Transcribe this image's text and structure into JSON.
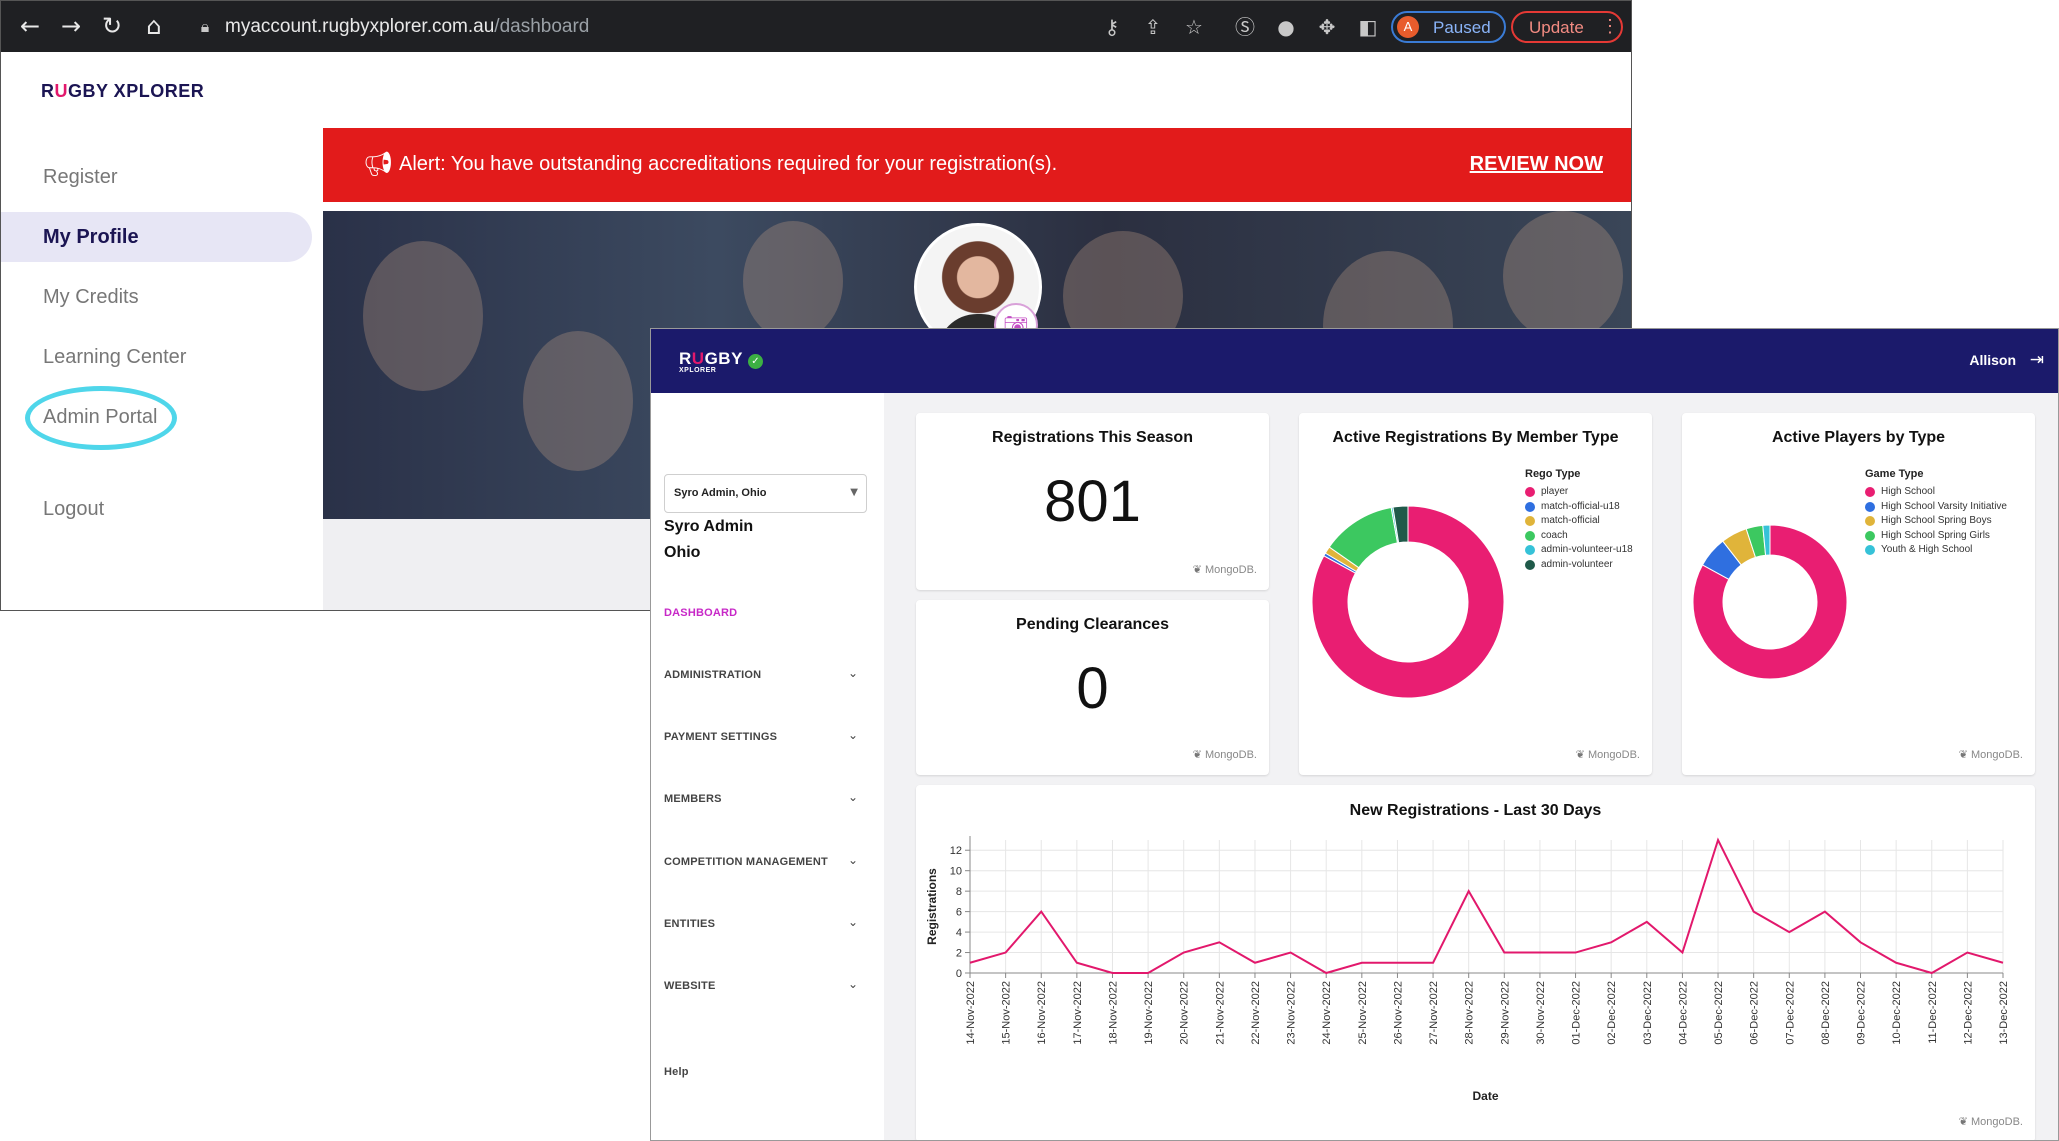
{
  "browser": {
    "url_domain": "myaccount.rugbyxplorer.com.au",
    "url_path": "/dashboard",
    "profile_initial": "A",
    "profile_status": "Paused",
    "update_label": "Update"
  },
  "portal": {
    "logo_prefix": "R",
    "logo_u": "U",
    "logo_suffix": "GBY XPLORER",
    "menu": {
      "register": "Register",
      "my_profile": "My Profile",
      "my_credits": "My Credits",
      "learning_center": "Learning Center",
      "admin_portal": "Admin Portal",
      "logout": "Logout"
    },
    "alert_text": "Alert: You have outstanding accreditations required for your registration(s).",
    "alert_link": "REVIEW NOW"
  },
  "admin": {
    "logo_prefix": "R",
    "logo_u": "U",
    "logo_suffix": "GBY",
    "logo_sub": "XPLORER",
    "user_name": "Allison",
    "org_select_value": "Syro Admin, Ohio",
    "org_name_line1": "Syro Admin",
    "org_name_line2": "Ohio",
    "nav": {
      "dashboard": "DASHBOARD",
      "administration": "ADMINISTRATION",
      "payment_settings": "PAYMENT SETTINGS",
      "members": "MEMBERS",
      "competition_management": "COMPETITION MANAGEMENT",
      "entities": "ENTITIES",
      "website": "WEBSITE",
      "help": "Help"
    },
    "watermark": "MongoDB.",
    "cards": {
      "registrations_title": "Registrations This Season",
      "registrations_value": "801",
      "pending_title": "Pending Clearances",
      "pending_value": "0",
      "member_type_title": "Active Registrations By Member Type",
      "players_type_title": "Active Players by Type",
      "line_title": "New Registrations - Last 30 Days"
    }
  },
  "colors": {
    "brand_navy": "#1b1a6b",
    "brand_pink": "#e2186c",
    "alert_red": "#e21b1b",
    "highlight_cyan": "#4fd6ea"
  },
  "chart_data": [
    {
      "type": "pie",
      "title": "Active Registrations By Member Type",
      "legend_title": "Rego Type",
      "legend_position": "top-right",
      "donut": true,
      "slices": [
        {
          "label": "player",
          "value": 83,
          "color": "#e91e72"
        },
        {
          "label": "match-official-u18",
          "value": 0.5,
          "color": "#2f6fe0"
        },
        {
          "label": "match-official",
          "value": 1.2,
          "color": "#e0b43a"
        },
        {
          "label": "coach",
          "value": 12.5,
          "color": "#3cc860"
        },
        {
          "label": "admin-volunteer-u18",
          "value": 0.3,
          "color": "#36c2d8"
        },
        {
          "label": "admin-volunteer",
          "value": 2.5,
          "color": "#1f5a4a"
        }
      ]
    },
    {
      "type": "pie",
      "title": "Active Players by Type",
      "legend_title": "Game Type",
      "legend_position": "top-right",
      "donut": true,
      "slices": [
        {
          "label": "High School",
          "value": 83,
          "color": "#e91e72"
        },
        {
          "label": "High School Varsity Initiative",
          "value": 6.5,
          "color": "#2f6fe0"
        },
        {
          "label": "High School Spring Boys",
          "value": 5.5,
          "color": "#e0b43a"
        },
        {
          "label": "High School Spring Girls",
          "value": 3.5,
          "color": "#3cc860"
        },
        {
          "label": "Youth & High School",
          "value": 1.5,
          "color": "#36c2d8"
        }
      ]
    },
    {
      "type": "line",
      "title": "New Registrations - Last 30 Days",
      "xlabel": "Date",
      "ylabel": "Registrations",
      "ylim": [
        0,
        13
      ],
      "yticks": [
        0,
        2,
        4,
        6,
        8,
        10,
        12
      ],
      "grid": true,
      "color": "#e2186c",
      "x": [
        "14-Nov-2022",
        "15-Nov-2022",
        "16-Nov-2022",
        "17-Nov-2022",
        "18-Nov-2022",
        "19-Nov-2022",
        "20-Nov-2022",
        "21-Nov-2022",
        "22-Nov-2022",
        "23-Nov-2022",
        "24-Nov-2022",
        "25-Nov-2022",
        "26-Nov-2022",
        "27-Nov-2022",
        "28-Nov-2022",
        "29-Nov-2022",
        "30-Nov-2022",
        "01-Dec-2022",
        "02-Dec-2022",
        "03-Dec-2022",
        "04-Dec-2022",
        "05-Dec-2022",
        "06-Dec-2022",
        "07-Dec-2022",
        "08-Dec-2022",
        "09-Dec-2022",
        "10-Dec-2022",
        "11-Dec-2022",
        "12-Dec-2022",
        "13-Dec-2022"
      ],
      "y": [
        1,
        2,
        6,
        1,
        0,
        0,
        2,
        3,
        1,
        2,
        0,
        1,
        1,
        1,
        8,
        2,
        2,
        2,
        3,
        5,
        2,
        13,
        6,
        4,
        6,
        3,
        1,
        0,
        2,
        1
      ]
    }
  ]
}
